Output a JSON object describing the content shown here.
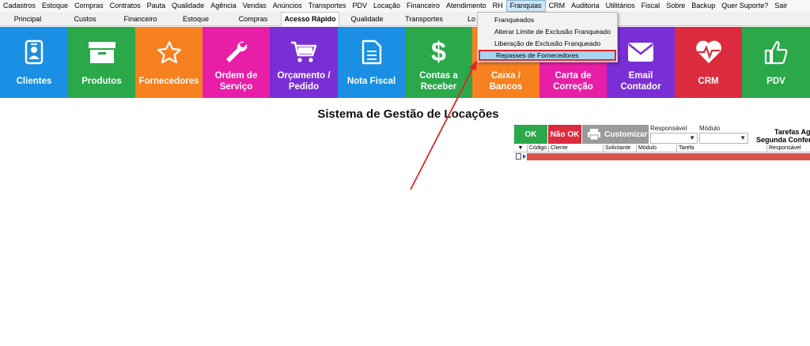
{
  "menubar": {
    "items": [
      "Cadastros",
      "Estoque",
      "Compras",
      "Contratos",
      "Pauta",
      "Qualidade",
      "Agência",
      "Vendas",
      "Anúncios",
      "Transportes",
      "PDV",
      "Locação",
      "Financeiro",
      "Atendimento",
      "RH",
      "Franquias",
      "CRM",
      "Auditoria",
      "Utilitários",
      "Fiscal",
      "Sobre",
      "Backup",
      "Quer Suporte?",
      "Sair"
    ],
    "active": "Franquias"
  },
  "tabs": [
    "Principal",
    "Custos",
    "Financeiro",
    "Estoque",
    "Compras",
    "Acesso Rápido",
    "Qualidade",
    "Transportes",
    "Lo"
  ],
  "selected_tab": "Acesso Rápido",
  "tiles": [
    {
      "label": "Clientes",
      "color": "#1a8fe3",
      "icon": "id-badge-icon"
    },
    {
      "label": "Produtos",
      "color": "#2aa84a",
      "icon": "box-icon"
    },
    {
      "label": "Fornecedores",
      "color": "#f7801f",
      "icon": "star-icon"
    },
    {
      "label": "Ordem de Serviço",
      "color": "#e81fa6",
      "icon": "wrench-icon"
    },
    {
      "label": "Orçamento / Pedido",
      "color": "#7a2fd6",
      "icon": "cart-icon"
    },
    {
      "label": "Nota Fiscal",
      "color": "#1a8fe3",
      "icon": "document-icon"
    },
    {
      "label": "Contas a Receber",
      "color": "#2aa84a",
      "icon": "dollar-icon"
    },
    {
      "label": "Caixa / Bancos",
      "color": "#f7801f",
      "icon": "cash-icon"
    },
    {
      "label": "Carta de Correção",
      "color": "#e81fa6",
      "icon": "pencil-icon"
    },
    {
      "label": "Email Contador",
      "color": "#7a2fd6",
      "icon": "envelope-icon"
    },
    {
      "label": "CRM",
      "color": "#dd2b3e",
      "icon": "heart-pulse-icon"
    },
    {
      "label": "PDV",
      "color": "#2aa84a",
      "icon": "thumbs-up-icon"
    }
  ],
  "page_title": "Sistema de Gestão de Locações",
  "buttons": {
    "ok": "OK",
    "nao_ok": "Não OK",
    "customizar": "Customizar"
  },
  "filters": {
    "responsavel": "Responsável",
    "modulo": "Módulo"
  },
  "tarefas": {
    "line1": "Tarefas Agu",
    "line2": "Segunda Conferê"
  },
  "grid": {
    "columns": [
      "Código",
      "Cliente",
      "Solicitante",
      "Módulo",
      "Tarefa",
      "Responsável"
    ]
  },
  "dropdown": {
    "items": [
      "Franqueados",
      "Alterar Limite de Exclusão Franqueado",
      "Liberação de Exclusão Franqueado",
      "Repasses de Fornecedores"
    ],
    "highlighted": "Repasses de Fornecedores"
  },
  "colors": {
    "ok": "#2aa84a",
    "nao_ok": "#dd2b3e",
    "customizar": "#9a9a9a",
    "grid_row": "#d9534f",
    "annotation": "#e0242a"
  }
}
